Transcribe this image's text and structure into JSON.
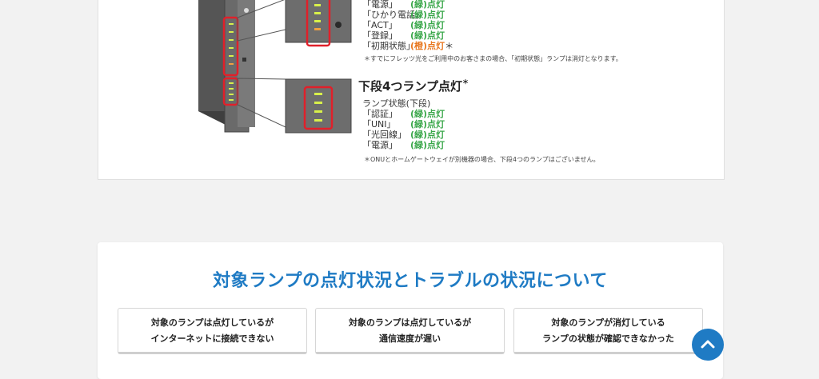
{
  "upper": {
    "lamp_list_top": [
      {
        "name": "「電源」",
        "status": "(緑)点灯",
        "color": "green"
      },
      {
        "name": "「ひかり電話」",
        "status": "(緑)点灯",
        "color": "green"
      },
      {
        "name": "「ACT」",
        "status": "(緑)点灯",
        "color": "green"
      },
      {
        "name": "「登録」",
        "status": "(緑)点灯",
        "color": "green"
      },
      {
        "name": "「初期状態」",
        "status": "(橙)点灯",
        "color": "orange",
        "mark": "＊"
      }
    ],
    "note_top": "＊すでにフレッツ光をご利用中のお客さまの場合、「初期状態」ランプは消灯となります。",
    "heading_lower": "下段4つランプ点灯",
    "heading_mark": "＊",
    "lamp_state_label": "ランプ状態(下段)",
    "lamp_list_bottom": [
      {
        "name": "「認証」",
        "status": "(緑)点灯",
        "color": "green"
      },
      {
        "name": "「UNI」",
        "status": "(緑)点灯",
        "color": "green"
      },
      {
        "name": "「光回線」",
        "status": "(緑)点灯",
        "color": "green"
      },
      {
        "name": "「電源」",
        "status": "(緑)点灯",
        "color": "green"
      }
    ],
    "note_bottom": "＊ONUとホームゲートウェイが別機器の場合、下段4つのランプはございません。"
  },
  "section": {
    "title": "対象ランプの点灯状況とトラブルの状況について",
    "cards": [
      {
        "line1": "対象のランプは点灯しているが",
        "line2": "インターネットに接続できない"
      },
      {
        "line1": "対象のランプは点灯しているが",
        "line2": "通信速度が遅い"
      },
      {
        "line1": "対象のランプが消灯している",
        "line2": "ランプの状態が確認できなかった"
      }
    ]
  },
  "icons": {
    "scroll_top": "chevron-up-icon"
  },
  "colors": {
    "accent": "#1f7bc4",
    "lamp_green": "#3aa74a",
    "lamp_orange": "#e8771f",
    "device_red": "#e0202a"
  }
}
